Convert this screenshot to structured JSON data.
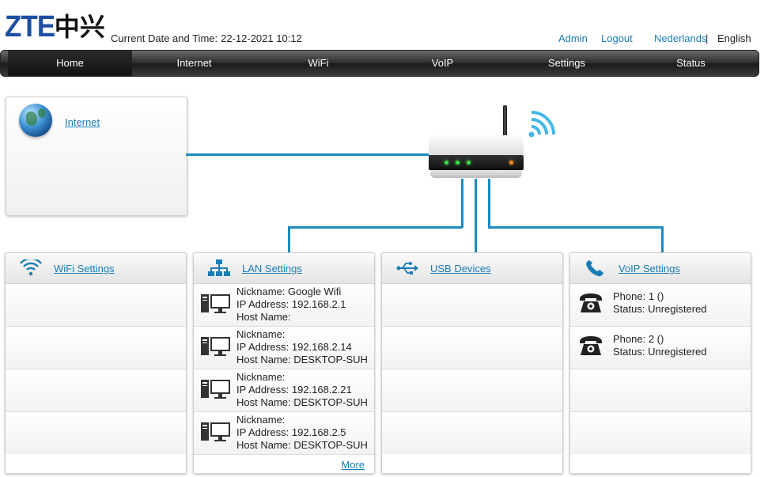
{
  "header": {
    "logo_text": "ZTE",
    "logo_cn": "中兴",
    "datetime_label": "Current Date and Time:",
    "datetime_value": "22-12-2021 10:12",
    "admin": "Admin",
    "logout": "Logout",
    "lang_nl": "Nederlands",
    "lang_sep": "|",
    "lang_en": "English"
  },
  "nav": {
    "items": [
      "Home",
      "Internet",
      "WiFi",
      "VoIP",
      "Settings",
      "Status"
    ],
    "active": "Home"
  },
  "internet": {
    "label": "Internet"
  },
  "panels": {
    "wifi": {
      "title": "WiFi Settings"
    },
    "lan": {
      "title": "LAN Settings",
      "devices": [
        {
          "nickname": "Nickname: Google Wifi",
          "ip": "IP Address: 192.168.2.1",
          "host": "Host Name:"
        },
        {
          "nickname": "Nickname:",
          "ip": "IP Address: 192.168.2.14",
          "host": "Host Name: DESKTOP-SUH"
        },
        {
          "nickname": "Nickname:",
          "ip": "IP Address: 192.168.2.21",
          "host": "Host Name: DESKTOP-SUH"
        },
        {
          "nickname": "Nickname:",
          "ip": "IP Address: 192.168.2.5",
          "host": "Host Name: DESKTOP-SUH"
        }
      ],
      "more": "More"
    },
    "usb": {
      "title": "USB Devices"
    },
    "voip": {
      "title": "VoIP Settings",
      "phones": [
        {
          "phone": "Phone: 1 ()",
          "status": "Status: Unregistered"
        },
        {
          "phone": "Phone: 2 ()",
          "status": "Status: Unregistered"
        }
      ]
    }
  },
  "colors": {
    "link": "#1a7db5",
    "line": "#1b8cbf",
    "logo_blue": "#1e50a2",
    "led_green": "#3fe04a",
    "led_orange": "#ff8a1f"
  }
}
